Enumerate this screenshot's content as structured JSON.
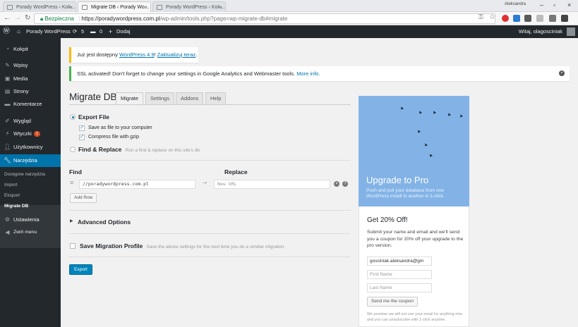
{
  "browser": {
    "tabs": [
      {
        "title": "Porady WordPress ‹ Kok…",
        "active": false
      },
      {
        "title": "Migrate DB ‹ Porady Wo…",
        "active": true
      },
      {
        "title": "Porady WordPress ‹ Kok…",
        "active": false
      }
    ],
    "window_user": "Aleksandra",
    "secure_label": "Bezpieczna",
    "url_host": "https://poradywordpress.com.pl",
    "url_path": "/wp-admin/tools.php?page=wp-migrate-db#migrate"
  },
  "adminbar": {
    "site_name": "Porady WordPress",
    "updates_count": "5",
    "comments_count": "0",
    "add_label": "Dodaj",
    "greeting": "Witaj, olagosciniak"
  },
  "sidebar": {
    "items": [
      {
        "label": "Kokpit",
        "icon": "dashboard-icon"
      },
      {
        "label": "Wpisy",
        "icon": "pin-icon"
      },
      {
        "label": "Media",
        "icon": "media-icon"
      },
      {
        "label": "Strony",
        "icon": "pages-icon"
      },
      {
        "label": "Komentarze",
        "icon": "comments-icon"
      },
      {
        "label": "Wygląd",
        "icon": "brush-icon"
      },
      {
        "label": "Wtyczki",
        "icon": "plugin-icon",
        "badge": "1"
      },
      {
        "label": "Użytkownicy",
        "icon": "users-icon"
      },
      {
        "label": "Narzędzia",
        "icon": "wrench-icon",
        "active": true
      },
      {
        "label": "Ustawienia",
        "icon": "settings-icon"
      },
      {
        "label": "Zwiń menu",
        "icon": "collapse-icon"
      }
    ],
    "submenu": [
      "Dostępne narzędzia",
      "Import",
      "Eksport",
      "Migrate DB"
    ]
  },
  "notices": {
    "update_prefix": "Już jest dostępny",
    "update_link": "WordPress 4.9",
    "update_action": "Zaktualizuj teraz",
    "ssl_text": "SSL activated!  Don't forget to change your settings in Google Analytics and Webmaster tools.",
    "ssl_link": "More info."
  },
  "page": {
    "title": "Migrate DB",
    "tabs": [
      "Migrate",
      "Settings",
      "Addons",
      "Help"
    ]
  },
  "form": {
    "export_label": "Export File",
    "save_as_file": "Save as file to your computer",
    "compress": "Compress file with gzip",
    "find_replace_label": "Find & Replace",
    "find_replace_desc": "Run a find & replace on this site's db",
    "find_header": "Find",
    "replace_header": "Replace",
    "find_value": "//poradywordpress.com.pl",
    "replace_placeholder": "New URL",
    "add_row": "Add Row",
    "advanced": "Advanced Options",
    "save_profile": "Save Migration Profile",
    "save_profile_desc": "Save the above settings for the next time you do a similiar migration",
    "export_button": "Export"
  },
  "promo": {
    "headline": "Upgrade to Pro",
    "subline": "Push and pull your database from one WordPress install to another in 1-click.",
    "offer_title": "Get 20% Off!",
    "offer_text": "Submit your name and email and we'll send you a coupon for 20% off your upgrade to the pro version.",
    "email_value": "gosciniak.aleksandra@gm",
    "first_name_placeholder": "First Name",
    "last_name_placeholder": "Last Name",
    "coupon_button": "Send me the coupon",
    "fine_print": "We promise we will not use your email for anything else and you can unsubscribe with 1-click anytime."
  },
  "colors": {
    "admin_dark": "#23282d",
    "accent_blue": "#0073aa",
    "promo_blue": "#83b3e6",
    "notice_yellow": "#ffb900",
    "notice_green": "#46b450"
  }
}
